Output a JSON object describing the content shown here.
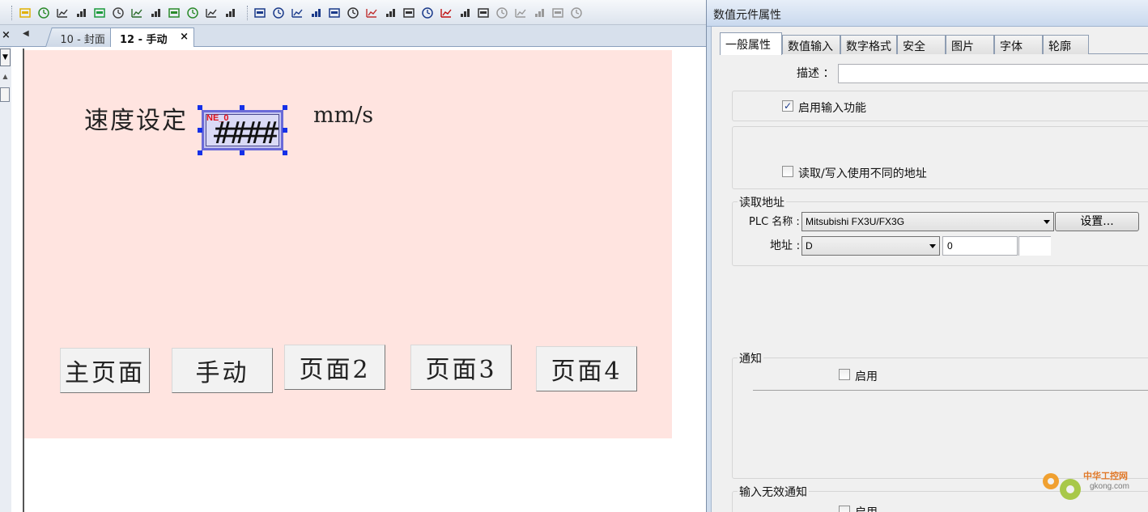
{
  "toolbar": {
    "icons": [
      "bulb-icon",
      "meter-icon",
      "word-lamp-icon",
      "numeric-icon",
      "shape-icon",
      "key-icon",
      "display-icon",
      "switch-icon",
      "grid-icon",
      "grid-alt-icon",
      "io-icon",
      "clock-dial-icon",
      "print-icon",
      "save-icon",
      "move-icon",
      "network-icon",
      "bar-chart-icon",
      "clock-icon",
      "trend-icon",
      "table-icon",
      "picture-icon",
      "scatter-icon",
      "minus-icon",
      "person-icon",
      "calc-icon",
      "disabled-a-icon",
      "disabled-b-icon",
      "disabled-c-icon",
      "disabled-d-icon",
      "disabled-e-icon"
    ]
  },
  "tabs": {
    "close_all": "×",
    "scroll_left": "◀",
    "items": [
      {
        "label": "10 - 封面",
        "active": false
      },
      {
        "label": "12 - 手动",
        "active": true,
        "close": "×"
      }
    ]
  },
  "screen": {
    "background": "#ffe4e0",
    "speed_label": "速度设定",
    "unit_label": "mm/s",
    "numeric_field": {
      "tag": "NE_0",
      "placeholder": "####"
    },
    "buttons": [
      "主页面",
      "手动",
      "页面2",
      "页面3",
      "页面4"
    ]
  },
  "dialog": {
    "title": "数值元件属性",
    "tabs": [
      "一般属性",
      "数值输入",
      "数字格式",
      "安全",
      "图片",
      "字体",
      "轮廓"
    ],
    "active_tab": "一般属性",
    "description_label": "描述 ：",
    "description_value": "",
    "enable_input_label": "启用输入功能",
    "enable_input_checked": true,
    "diff_address_label": "读取/写入使用不同的地址",
    "diff_address_checked": false,
    "read_address": {
      "group_title": "读取地址",
      "plc_label": "PLC 名称 :",
      "plc_value": "Mitsubishi FX3U/FX3G",
      "settings_button": "设置...",
      "address_label": "地址 :",
      "address_type": "D",
      "address_value": "0"
    },
    "notify": {
      "group_title": "通知",
      "enable_label": "启用",
      "checked": false
    },
    "invalid_notify": {
      "group_title": "输入无效通知",
      "enable_label": "启用"
    }
  },
  "watermark": {
    "brand": "中华工控网",
    "url": "gkong.com"
  }
}
